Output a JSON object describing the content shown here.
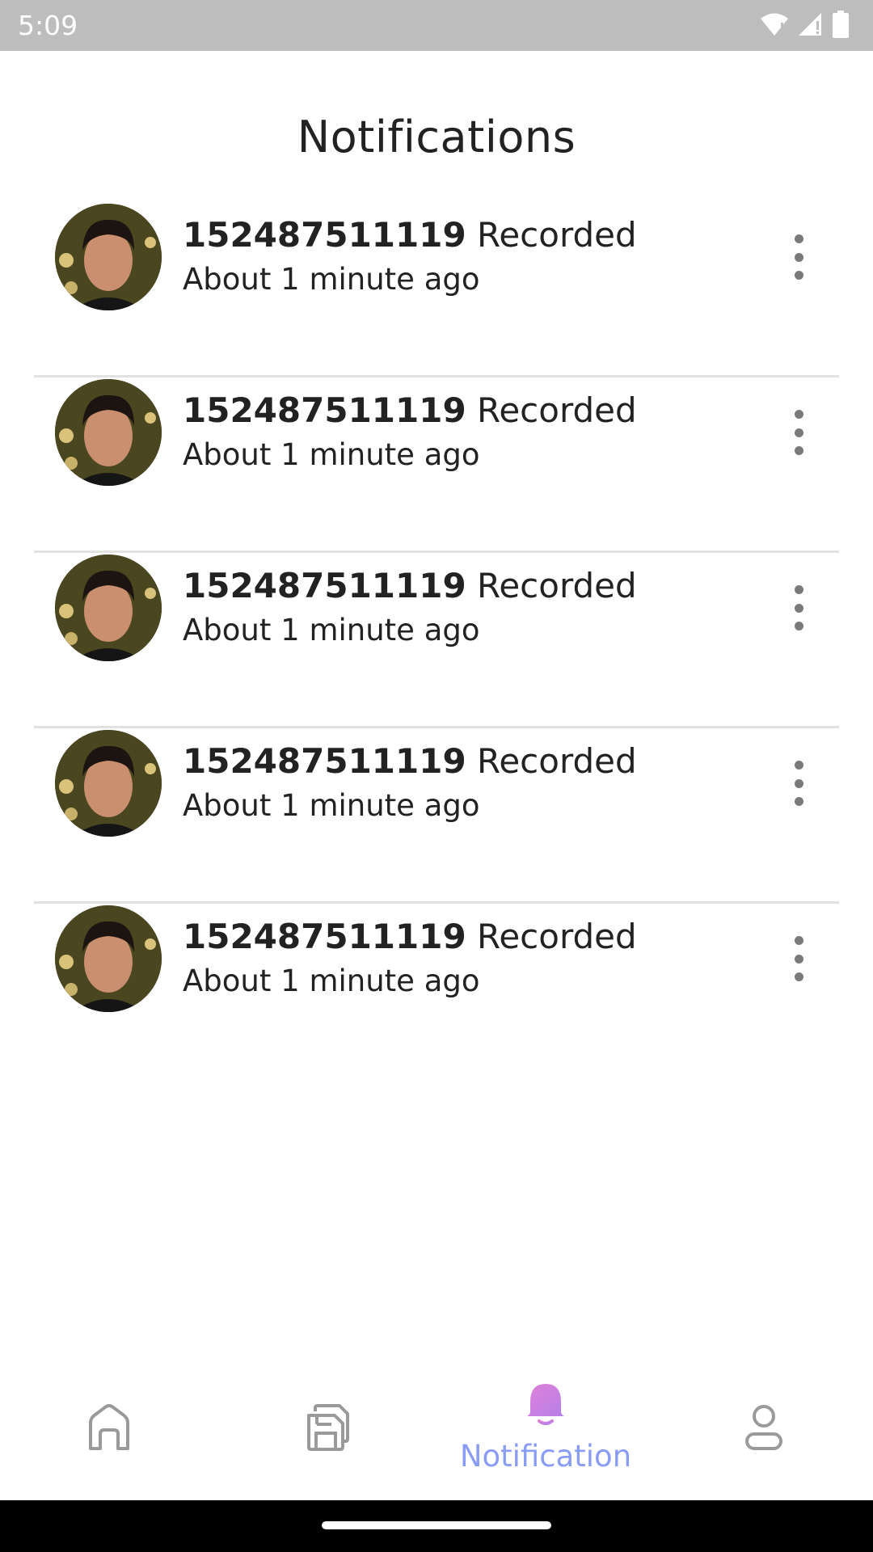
{
  "status_bar": {
    "time": "5:09"
  },
  "header": {
    "title": "Notifications"
  },
  "notifications": [
    {
      "id_text": "152487511119",
      "action": "Recorded",
      "time_ago": "About 1 minute ago"
    },
    {
      "id_text": "152487511119",
      "action": "Recorded",
      "time_ago": "About 1 minute ago"
    },
    {
      "id_text": "152487511119",
      "action": "Recorded",
      "time_ago": "About 1 minute ago"
    },
    {
      "id_text": "152487511119",
      "action": "Recorded",
      "time_ago": "About 1 minute ago"
    },
    {
      "id_text": "152487511119",
      "action": "Recorded",
      "time_ago": "About 1 minute ago"
    }
  ],
  "bottom_nav": {
    "items": [
      {
        "icon": "home-icon",
        "label": ""
      },
      {
        "icon": "save-icon",
        "label": ""
      },
      {
        "icon": "bell-icon",
        "label": "Notification",
        "active": true
      },
      {
        "icon": "profile-icon",
        "label": ""
      }
    ]
  },
  "colors": {
    "accent": "#8a9cf3",
    "bell_gradient_start": "#e081d8",
    "bell_gradient_end": "#b57fe9",
    "status_bar": "#bdbdbd",
    "divider": "#e2e2e2"
  }
}
